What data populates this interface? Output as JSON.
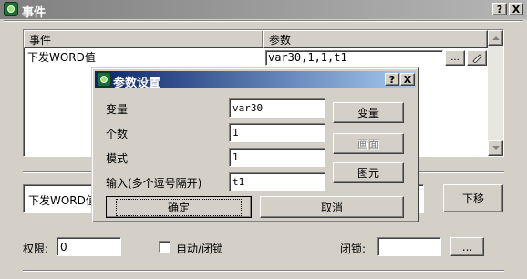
{
  "window": {
    "title": "事件",
    "help_label": "?",
    "close_label": "X"
  },
  "event_list": {
    "columns": [
      "事件",
      "参数"
    ],
    "rows": [
      {
        "event": "下发WORD值",
        "param": "var30,1,1,t1"
      }
    ],
    "cell_button_label": "..."
  },
  "selected_event": {
    "value": "下发WORD值"
  },
  "move_down_label": "下移",
  "permission": {
    "label": "权限:",
    "value": "0"
  },
  "auto_lock": {
    "label": "自动/闭锁",
    "checked": false
  },
  "lock": {
    "label": "闭锁:",
    "value": "",
    "browse_label": "..."
  },
  "dialog": {
    "title": "参数设置",
    "help_label": "?",
    "close_label": "X",
    "fields": [
      {
        "label": "变量",
        "value": "var30",
        "button": "变量",
        "enabled": true
      },
      {
        "label": "个数",
        "value": "1",
        "button": "画面",
        "enabled": false
      },
      {
        "label": "模式",
        "value": "1",
        "button": "图元",
        "enabled": true
      },
      {
        "label": "输入(多个逗号隔开)",
        "value": "t1"
      }
    ],
    "ok_label": "确定",
    "cancel_label": "取消"
  }
}
